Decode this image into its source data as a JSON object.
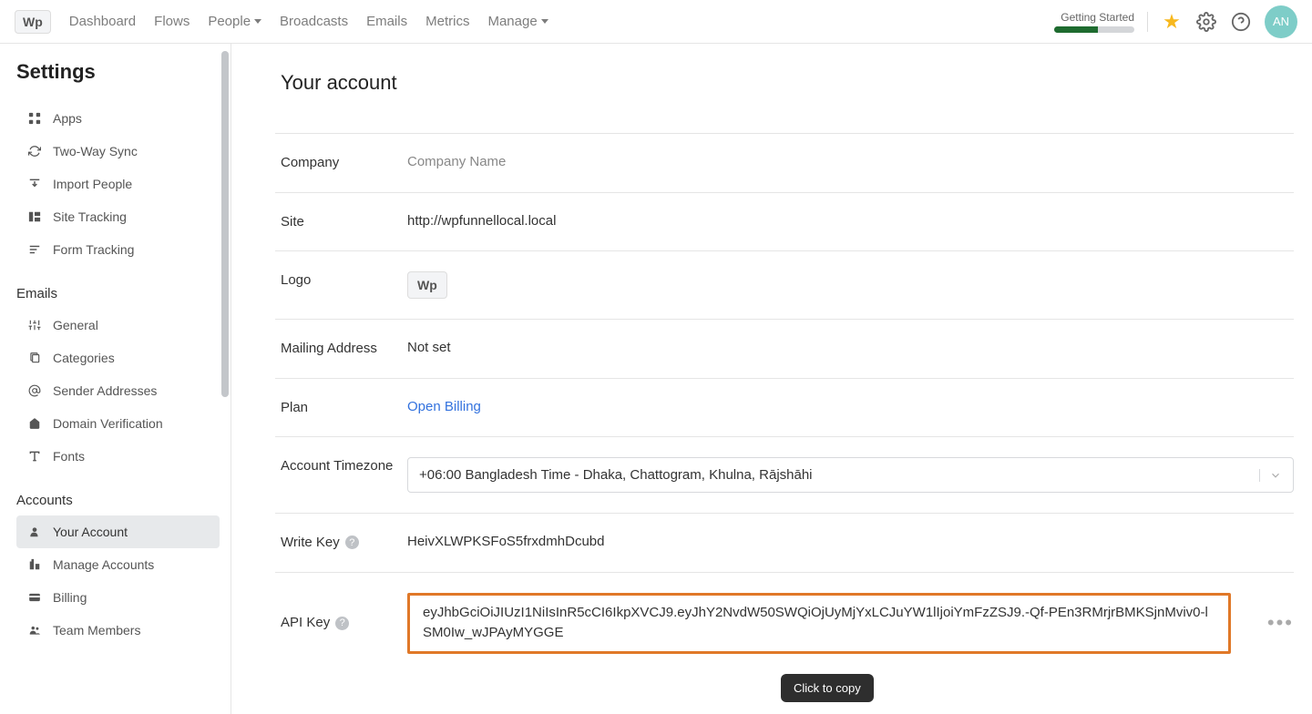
{
  "topnav": {
    "logo": "Wp",
    "links": [
      "Dashboard",
      "Flows",
      "People",
      "Broadcasts",
      "Emails",
      "Metrics",
      "Manage"
    ],
    "getting_started": "Getting Started",
    "progress_pct": 55,
    "avatar_initials": "AN"
  },
  "sidebar": {
    "title": "Settings",
    "groups": [
      {
        "title": null,
        "items": [
          {
            "icon": "grid",
            "label": "Apps"
          },
          {
            "icon": "sync",
            "label": "Two-Way Sync"
          },
          {
            "icon": "import",
            "label": "Import People"
          },
          {
            "icon": "site-tracking",
            "label": "Site Tracking"
          },
          {
            "icon": "form-tracking",
            "label": "Form Tracking"
          }
        ]
      },
      {
        "title": "Emails",
        "items": [
          {
            "icon": "sliders",
            "label": "General"
          },
          {
            "icon": "stack",
            "label": "Categories"
          },
          {
            "icon": "at",
            "label": "Sender Addresses"
          },
          {
            "icon": "home",
            "label": "Domain Verification"
          },
          {
            "icon": "type",
            "label": "Fonts"
          }
        ]
      },
      {
        "title": "Accounts",
        "items": [
          {
            "icon": "user",
            "label": "Your Account",
            "active": true
          },
          {
            "icon": "building",
            "label": "Manage Accounts"
          },
          {
            "icon": "card",
            "label": "Billing"
          },
          {
            "icon": "people",
            "label": "Team Members"
          }
        ]
      }
    ]
  },
  "main": {
    "title": "Your account",
    "rows": {
      "company": {
        "label": "Company",
        "value": "Company Name"
      },
      "site": {
        "label": "Site",
        "value": "http://wpfunnellocal.local"
      },
      "logo": {
        "label": "Logo",
        "value": "Wp"
      },
      "mailing": {
        "label": "Mailing Address",
        "value": "Not set"
      },
      "plan": {
        "label": "Plan",
        "value": "Open Billing"
      },
      "timezone": {
        "label": "Account Timezone",
        "value": "+06:00 Bangladesh Time - Dhaka, Chattogram, Khulna, Rājshāhi"
      },
      "writekey": {
        "label": "Write Key",
        "value": "HeivXLWPKSFoS5frxdmhDcubd"
      },
      "apikey": {
        "label": "API Key",
        "value": "eyJhbGciOiJIUzI1NiIsInR5cCI6IkpXVCJ9.eyJhY2NvdW50SWQiOjUyMjYxLCJuYW1lIjoiYmFzZSJ9.-Qf-PEn3RMrjrBMKSjnMviv0-lSM0Iw_wJPAyMYGGE"
      }
    },
    "tooltip": "Click to copy"
  }
}
